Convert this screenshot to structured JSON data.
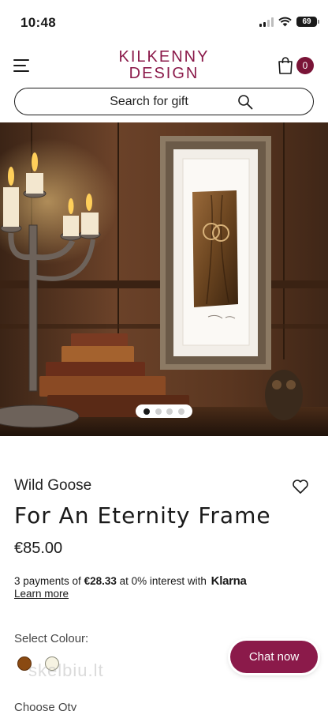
{
  "status": {
    "time": "10:48",
    "battery": "69"
  },
  "header": {
    "logo_line1": "KILKENNY",
    "logo_line2": "DESIGN",
    "cart_count": "0"
  },
  "search": {
    "placeholder": "Search for gift"
  },
  "carousel": {
    "slides": 4,
    "active_slide": 1
  },
  "product": {
    "brand": "Wild Goose",
    "title": "For An Eternity Frame",
    "price": "€85.00",
    "klarna_prefix": "3 payments of ",
    "klarna_amount": "€28.33",
    "klarna_suffix": " at 0% interest with ",
    "klarna_brand": "Klarna",
    "learn_more": "Learn more",
    "select_colour": "Select Colour:",
    "colours": [
      "#8a4a12",
      "#f6f3e2"
    ],
    "choose_qty": "Choose Qty"
  },
  "chat": {
    "label": "Chat now"
  },
  "watermark": "skelbiu.lt",
  "colors": {
    "brand": "#8b1a4a",
    "badge": "#7a1437"
  }
}
